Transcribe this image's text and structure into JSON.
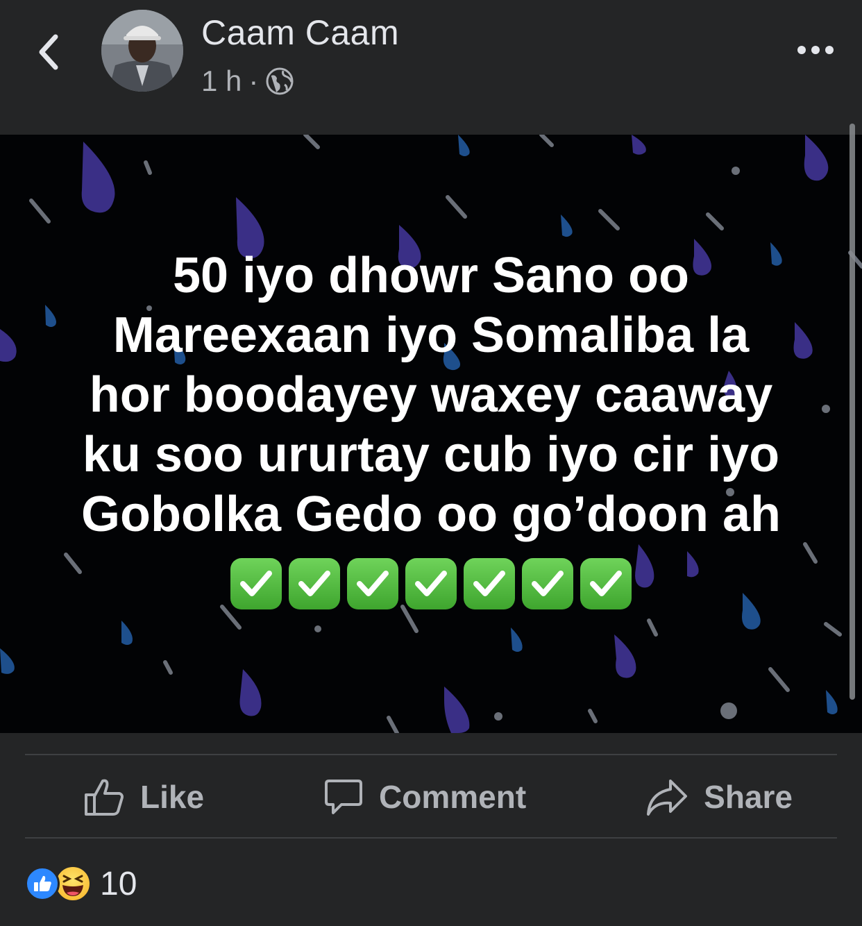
{
  "header": {
    "author": "Caam Caam",
    "time": "1 h",
    "separator": "·",
    "privacy_icon": "globe-icon",
    "back_icon": "chevron-left-icon",
    "more_icon": "more-horizontal-icon"
  },
  "post": {
    "text": "50 iyo dhowr Sano oo\nMareexaan iyo Somaliba la\nhor boodayey waxey caaway\nku soo ururtay cub iyo cir iyo\nGobolka Gedo oo go’doon ah",
    "emoji_checks": [
      "✔",
      "✔",
      "✔",
      "✔",
      "✔",
      "✔",
      "✔"
    ],
    "background": "#020305",
    "drop_colors": [
      "#3a2f86",
      "#1e4f8c",
      "#6a6f78"
    ]
  },
  "actions": {
    "like_label": "Like",
    "comment_label": "Comment",
    "share_label": "Share"
  },
  "reactions": {
    "types": [
      "like-reaction-icon",
      "haha-reaction-icon"
    ],
    "count": "10"
  },
  "colors": {
    "panel": "#242526",
    "text_primary": "#e4e6eb",
    "text_secondary": "#b0b3b8",
    "like_blue": "#2d88ff"
  }
}
